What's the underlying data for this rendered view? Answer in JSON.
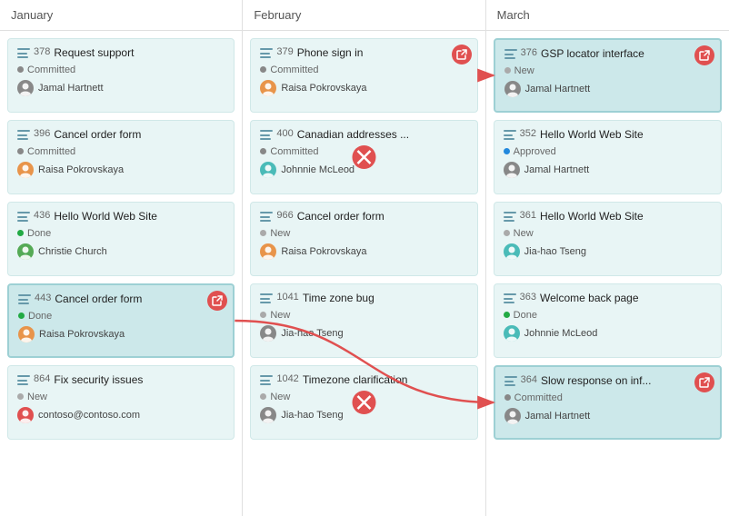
{
  "colors": {
    "accent": "#e05050",
    "teal_card_bg": "#cce8ea",
    "default_card_bg": "#e8f5f5"
  },
  "columns": [
    {
      "id": "january",
      "header": "January",
      "cards": [
        {
          "id": "378",
          "title": "Request support",
          "status": "Committed",
          "status_type": "committed",
          "user": "Jamal Hartnett",
          "avatar_color": "gray",
          "has_link": false,
          "highlighted": false
        },
        {
          "id": "396",
          "title": "Cancel order form",
          "status": "Committed",
          "status_type": "committed",
          "user": "Raisa Pokrovskaya",
          "avatar_color": "orange",
          "has_link": false,
          "highlighted": false
        },
        {
          "id": "436",
          "title": "Hello World Web Site",
          "status": "Done",
          "status_type": "done",
          "user": "Christie Church",
          "avatar_color": "green",
          "has_link": false,
          "highlighted": false
        },
        {
          "id": "443",
          "title": "Cancel order form",
          "status": "Done",
          "status_type": "done",
          "user": "Raisa Pokrovskaya",
          "avatar_color": "orange",
          "has_link": true,
          "highlighted": true
        },
        {
          "id": "864",
          "title": "Fix security issues",
          "status": "New",
          "status_type": "new",
          "user": "contoso@contoso.com",
          "avatar_color": "red",
          "has_link": false,
          "highlighted": false
        }
      ]
    },
    {
      "id": "february",
      "header": "February",
      "cards": [
        {
          "id": "379",
          "title": "Phone sign in",
          "status": "Committed",
          "status_type": "committed",
          "user": "Raisa Pokrovskaya",
          "avatar_color": "orange",
          "has_link": true,
          "highlighted": false
        },
        {
          "id": "400",
          "title": "Canadian addresses ...",
          "status": "Committed",
          "status_type": "committed",
          "user": "Johnnie McLeod",
          "avatar_color": "teal",
          "has_link": false,
          "highlighted": false,
          "has_x": true
        },
        {
          "id": "966",
          "title": "Cancel order form",
          "status": "New",
          "status_type": "new",
          "user": "Raisa Pokrovskaya",
          "avatar_color": "orange",
          "has_link": false,
          "highlighted": false
        },
        {
          "id": "1041",
          "title": "Time zone bug",
          "status": "New",
          "status_type": "new",
          "user": "Jia-hao Tseng",
          "avatar_color": "gray",
          "has_link": false,
          "highlighted": false
        },
        {
          "id": "1042",
          "title": "Timezone clarification",
          "status": "New",
          "status_type": "new",
          "user": "Jia-hao Tseng",
          "avatar_color": "gray",
          "has_link": false,
          "highlighted": false,
          "has_x": true
        }
      ]
    },
    {
      "id": "march",
      "header": "March",
      "cards": [
        {
          "id": "376",
          "title": "GSP locator interface",
          "status": "New",
          "status_type": "new",
          "user": "Jamal Hartnett",
          "avatar_color": "gray",
          "has_link": true,
          "highlighted": true
        },
        {
          "id": "352",
          "title": "Hello World Web Site",
          "status": "Approved",
          "status_type": "approved",
          "user": "Jamal Hartnett",
          "avatar_color": "gray",
          "has_link": false,
          "highlighted": false
        },
        {
          "id": "361",
          "title": "Hello World Web Site",
          "status": "New",
          "status_type": "new",
          "user": "Jia-hao Tseng",
          "avatar_color": "teal",
          "has_link": false,
          "highlighted": false
        },
        {
          "id": "363",
          "title": "Welcome back page",
          "status": "Done",
          "status_type": "done",
          "user": "Johnnie McLeod",
          "avatar_color": "teal",
          "has_link": false,
          "highlighted": false
        },
        {
          "id": "364",
          "title": "Slow response on inf...",
          "status": "Committed",
          "status_type": "committed",
          "user": "Jamal Hartnett",
          "avatar_color": "gray",
          "has_link": true,
          "highlighted": true
        }
      ]
    }
  ]
}
